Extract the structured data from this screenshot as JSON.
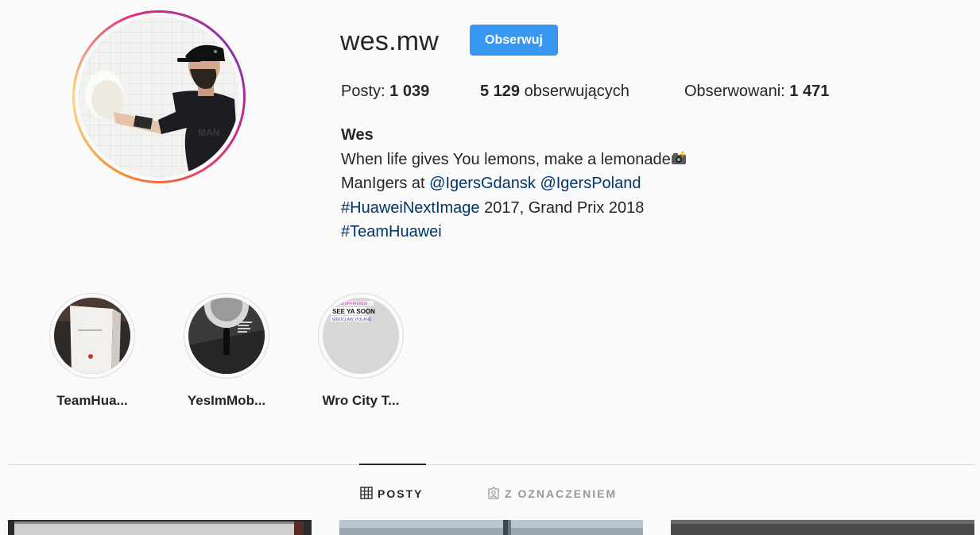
{
  "profile": {
    "username": "wes.mw",
    "follow_label": "Obserwuj",
    "avatar_icon": "profile-photo"
  },
  "stats": {
    "posts_label": "Posty:",
    "posts_count": "1 039",
    "followers_count": "5 129",
    "followers_label": "obserwujących",
    "following_label": "Obserwowani:",
    "following_count": "1 471"
  },
  "bio": {
    "full_name": "Wes",
    "line1": "When life gives You lemons, make a lemonade",
    "line1_emoji": "camera-with-flash-icon",
    "line2_prefix": "ManIgers at ",
    "line2_link1": "@IgersGdansk",
    "line2_link2": "@IgersPoland",
    "line3_link": "#HuaweiNextImage",
    "line3_suffix": " 2017, Grand Prix 2018",
    "line4_link": "#TeamHuawei"
  },
  "highlights": [
    {
      "label": "TeamHua..."
    },
    {
      "label": "YesImMob..."
    },
    {
      "label": "Wro City T..."
    }
  ],
  "highlight_story_text": {
    "tag": "#LAKEUPFRIENDS",
    "headline": "SEE YA SOON",
    "location": "WROCLAW, POLAND"
  },
  "tabs": {
    "posts": "POSTY",
    "tagged": "Z OZNACZENIEM"
  },
  "colors": {
    "primary_button": "#3897f0",
    "text": "#262626",
    "link": "#003569",
    "divider": "#dbdbdb",
    "background": "#fafafa"
  }
}
